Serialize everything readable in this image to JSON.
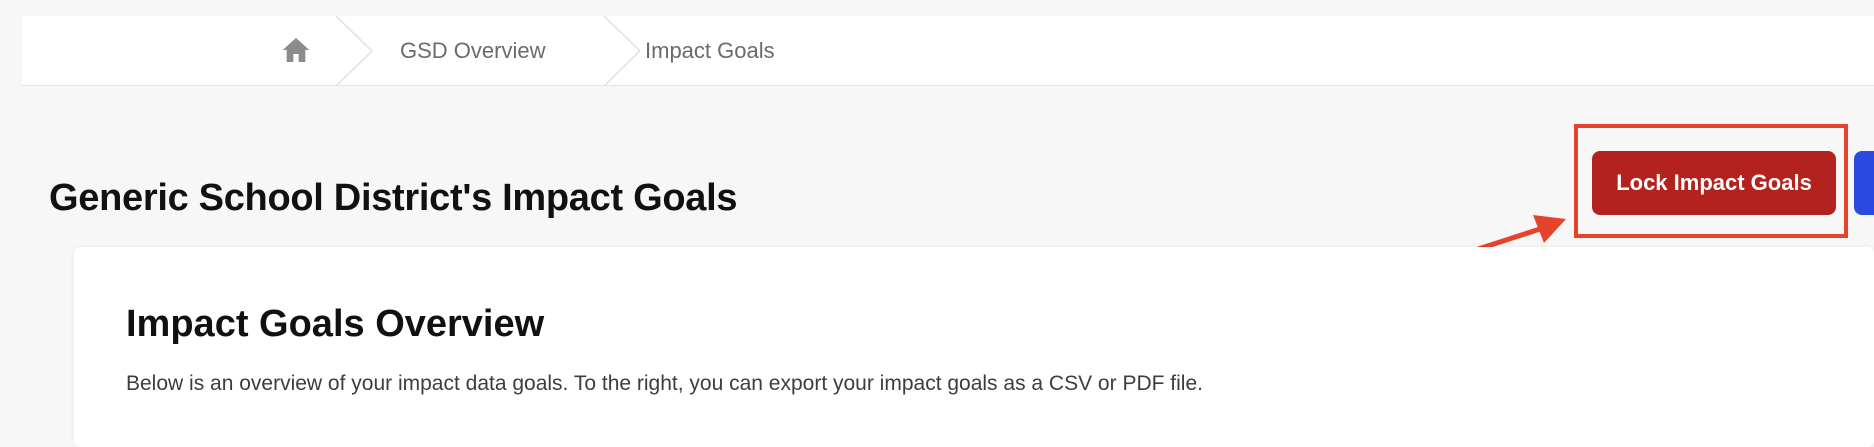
{
  "breadcrumb": {
    "home_icon": "home-icon",
    "items": [
      {
        "label": "GSD Overview"
      },
      {
        "label": "Impact Goals"
      }
    ]
  },
  "page": {
    "title": "Generic School District's Impact Goals"
  },
  "actions": {
    "lock_label": "Lock Impact Goals",
    "lock_color": "#b3221f",
    "secondary_color": "#2a49e0"
  },
  "annotation": {
    "color": "#e5432b"
  },
  "overview": {
    "title": "Impact Goals Overview",
    "description": "Below is an overview of your impact data goals. To the right, you can export your impact goals as a CSV or PDF file."
  }
}
